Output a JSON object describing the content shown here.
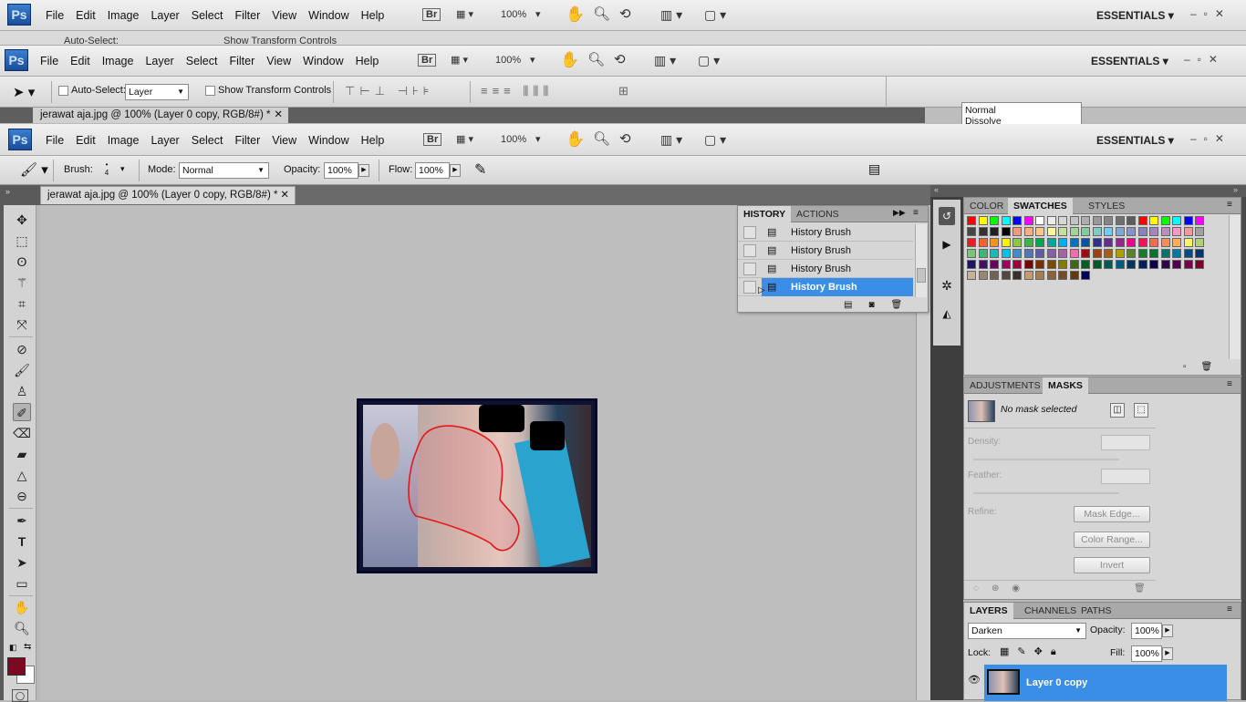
{
  "app": {
    "logo": "Ps",
    "workspace": "ESSENTIALS",
    "zoom": "100%",
    "bridge": "Br"
  },
  "menu": [
    "File",
    "Edit",
    "Image",
    "Layer",
    "Select",
    "Filter",
    "View",
    "Window",
    "Help"
  ],
  "ghost_options": {
    "auto_select_label": "Auto-Select:",
    "auto_select_value": "Layer",
    "show_transform": "Show Transform Controls"
  },
  "ghost_doc_tab": "jerawat aja.jpg @ 100% (Layer 0 copy, RGB/8#) *",
  "ghost_dropdown": [
    "Normal",
    "Dissolve"
  ],
  "options": {
    "brush_label": "Brush:",
    "brush_size": "4",
    "mode_label": "Mode:",
    "mode_value": "Normal",
    "opacity_label": "Opacity:",
    "opacity_value": "100%",
    "flow_label": "Flow:",
    "flow_value": "100%"
  },
  "document": {
    "tab_title": "jerawat aja.jpg @ 100% (Layer 0 copy, RGB/8#) *"
  },
  "history": {
    "tabs": [
      "HISTORY",
      "ACTIONS"
    ],
    "items": [
      "History Brush",
      "History Brush",
      "History Brush",
      "History Brush"
    ]
  },
  "color_panel": {
    "tabs": [
      "COLOR",
      "SWATCHES",
      "STYLES"
    ]
  },
  "swatches": [
    "#ff0000",
    "#ffff00",
    "#00ff00",
    "#00ffff",
    "#0000ff",
    "#ff00ff",
    "#ffffff",
    "#ebebeb",
    "#d6d6d6",
    "#c2c2c2",
    "#adadad",
    "#999999",
    "#858585",
    "#707070",
    "#5c5c5c",
    "#ff0000",
    "#ffff00",
    "#00ff00",
    "#00ffff",
    "#0000ff",
    "#ff00ff",
    "#474747",
    "#333333",
    "#1f1f1f",
    "#000000",
    "#f7977a",
    "#f9ad81",
    "#fdc68a",
    "#fff79a",
    "#c4df9b",
    "#a2d39c",
    "#82ca9d",
    "#7bcdc8",
    "#6ecff6",
    "#7ea7d8",
    "#8493ca",
    "#8882be",
    "#a187be",
    "#bc8dbf",
    "#f49ac2",
    "#f6989d",
    "#a0a0a0",
    "#ed1c24",
    "#f26522",
    "#f7941d",
    "#fff200",
    "#8dc73f",
    "#39b54a",
    "#00a651",
    "#00a99d",
    "#00aeef",
    "#0072bc",
    "#0054a6",
    "#2e3192",
    "#662d91",
    "#92278f",
    "#ec008c",
    "#ed145b",
    "#f26c4f",
    "#f68e55",
    "#fbaf5c",
    "#fff467",
    "#acd372",
    "#7cc576",
    "#3bb878",
    "#1abbb4",
    "#00bff3",
    "#438ccb",
    "#5574b9",
    "#605ca8",
    "#855fa8",
    "#a763a8",
    "#f06ea9",
    "#9e0b0f",
    "#a0410d",
    "#a3620a",
    "#aba000",
    "#598527",
    "#1a7b30",
    "#007236",
    "#00746b",
    "#0076a3",
    "#004b80",
    "#003471",
    "#1b1464",
    "#440e62",
    "#630460",
    "#9e005d",
    "#9e0039",
    "#790000",
    "#7b2e00",
    "#7d4900",
    "#827b00",
    "#406618",
    "#005e20",
    "#005826",
    "#005952",
    "#005b7f",
    "#003663",
    "#002157",
    "#0d004c",
    "#32004b",
    "#4b0049",
    "#7b0046",
    "#7a0026",
    "#c7b299",
    "#998675",
    "#736357",
    "#534741",
    "#37302d",
    "#c69c6d",
    "#a67c52",
    "#8c6239",
    "#754c24",
    "#603913",
    "#00005c"
  ],
  "masks": {
    "tabs": [
      "ADJUSTMENTS",
      "MASKS"
    ],
    "status": "No mask selected",
    "density_label": "Density:",
    "feather_label": "Feather:",
    "refine_label": "Refine:",
    "buttons": [
      "Mask Edge...",
      "Color Range...",
      "Invert"
    ]
  },
  "layers": {
    "tabs": [
      "LAYERS",
      "CHANNELS",
      "PATHS"
    ],
    "blend_mode": "Darken",
    "opacity_label": "Opacity:",
    "opacity_value": "100%",
    "lock_label": "Lock:",
    "fill_label": "Fill:",
    "fill_value": "100%",
    "items": [
      {
        "name": "Layer 0 copy",
        "selected": true
      }
    ]
  },
  "colors": {
    "foreground": "#7a0a22",
    "background": "#ffffff",
    "selection": "#3a8ee6"
  }
}
